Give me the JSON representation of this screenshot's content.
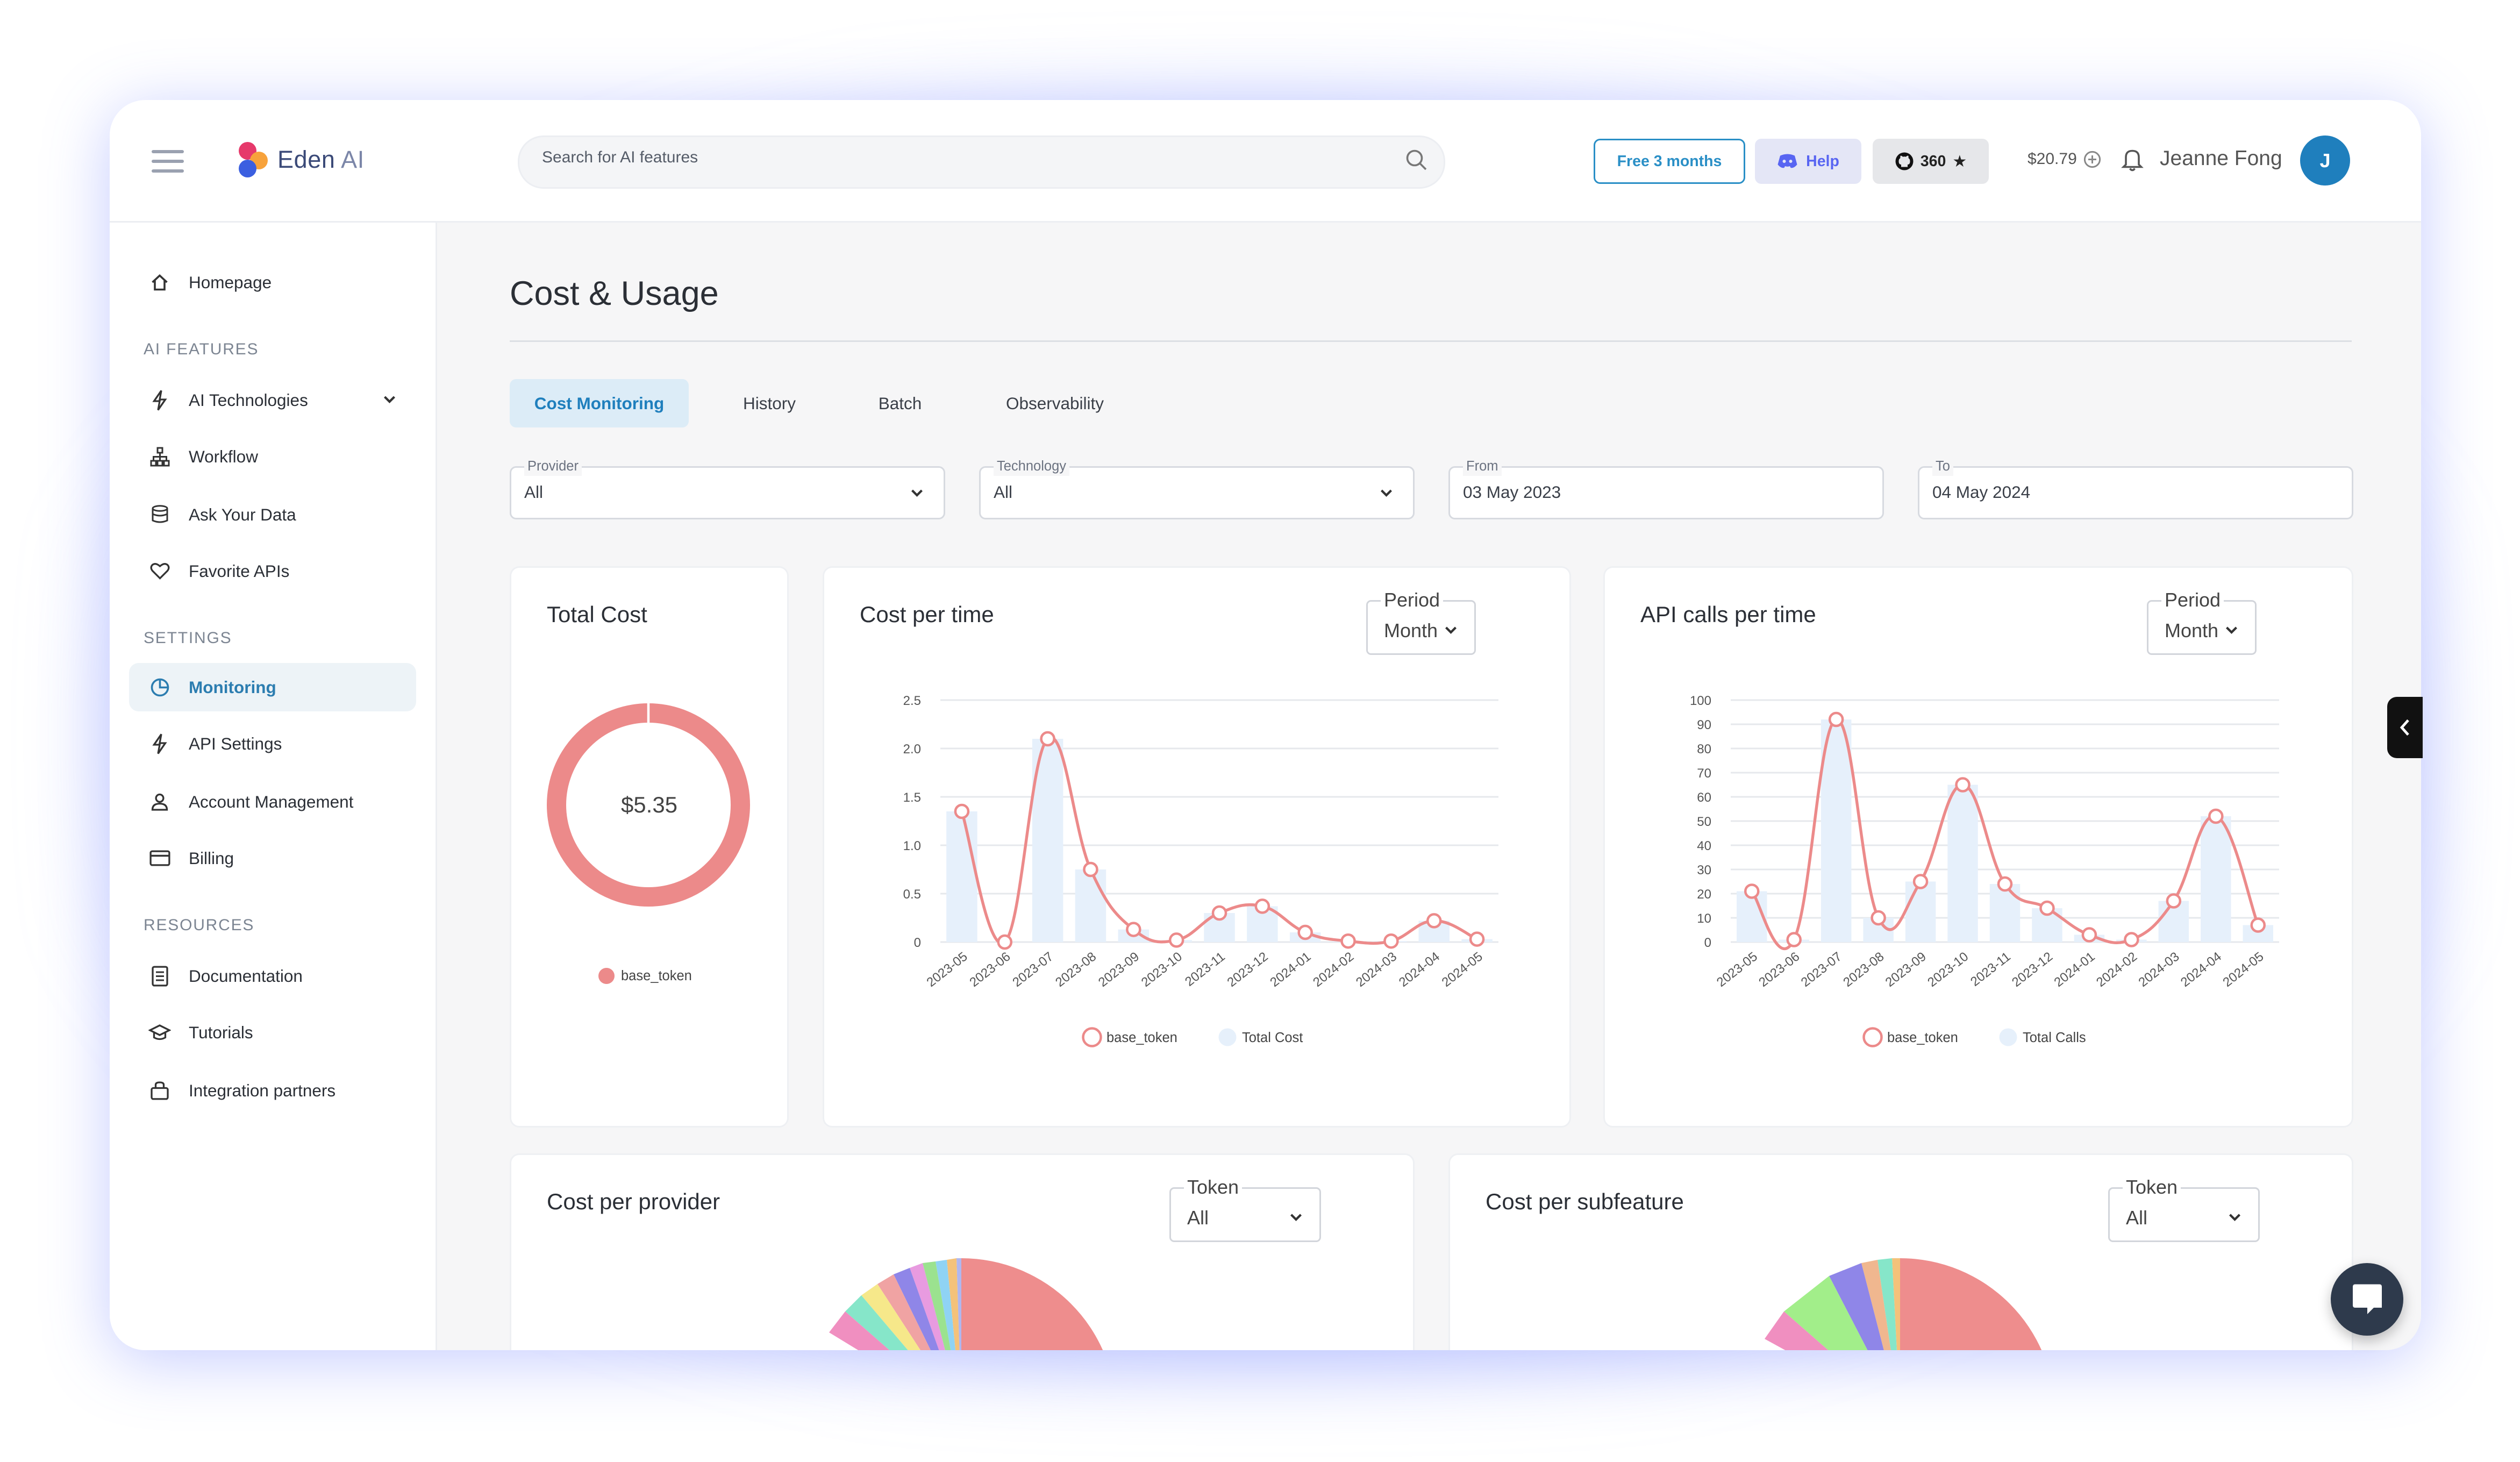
{
  "app": {
    "logo_text_main": "Eden",
    "logo_text_suffix": "AI"
  },
  "topbar": {
    "search_placeholder": "Search for AI features",
    "free_label": "Free 3 months",
    "help_label": "Help",
    "github_stars": "360",
    "balance": "$20.79",
    "username": "Jeanne Fong",
    "avatar_initial": "J"
  },
  "sidebar": {
    "homepage": "Homepage",
    "section_ai": "AI FEATURES",
    "ai_technologies": "AI Technologies",
    "workflow": "Workflow",
    "ask_your_data": "Ask Your Data",
    "favorite_apis": "Favorite APIs",
    "section_settings": "SETTINGS",
    "monitoring": "Monitoring",
    "api_settings": "API Settings",
    "account_management": "Account Management",
    "billing": "Billing",
    "section_resources": "RESOURCES",
    "documentation": "Documentation",
    "tutorials": "Tutorials",
    "integration_partners": "Integration partners"
  },
  "main": {
    "title": "Cost & Usage",
    "tabs": [
      "Cost Monitoring",
      "History",
      "Batch",
      "Observability"
    ],
    "filters": {
      "provider_label": "Provider",
      "provider_value": "All",
      "technology_label": "Technology",
      "technology_value": "All",
      "from_label": "From",
      "from_value": "03 May 2023",
      "to_label": "To",
      "to_value": "04 May 2024"
    }
  },
  "cards": {
    "total_cost_title": "Total Cost",
    "total_cost_value": "$5.35",
    "total_cost_legend": "base_token",
    "cost_per_time_title": "Cost per time",
    "api_calls_title": "API calls per time",
    "period_label": "Period",
    "period_value": "Month",
    "cost_per_provider_title": "Cost per provider",
    "cost_per_subfeature_title": "Cost per subfeature",
    "token_label": "Token",
    "token_value": "All"
  },
  "colors": {
    "accent": "#1f7fbd",
    "line": "#ec8a8a",
    "bar": "#e6f0fb"
  },
  "chart_data": [
    {
      "type": "line",
      "title": "Cost per time",
      "categories": [
        "2023-05",
        "2023-06",
        "2023-07",
        "2023-08",
        "2023-09",
        "2023-10",
        "2023-11",
        "2023-12",
        "2024-01",
        "2024-02",
        "2024-03",
        "2024-04",
        "2024-05"
      ],
      "yticks": [
        "0",
        "0.5",
        "1.0",
        "1.5",
        "2.0",
        "2.5"
      ],
      "ylim": [
        0,
        2.5
      ],
      "series": [
        {
          "name": "base_token",
          "kind": "line",
          "values": [
            1.35,
            0.0,
            2.1,
            0.75,
            0.13,
            0.02,
            0.3,
            0.37,
            0.1,
            0.01,
            0.01,
            0.22,
            0.03
          ]
        },
        {
          "name": "Total Cost",
          "kind": "bar",
          "values": [
            1.35,
            0.0,
            2.1,
            0.75,
            0.13,
            0.02,
            0.3,
            0.37,
            0.1,
            0.01,
            0.01,
            0.22,
            0.03
          ]
        }
      ],
      "grid": true,
      "legend": "bottom"
    },
    {
      "type": "line",
      "title": "API calls per time",
      "categories": [
        "2023-05",
        "2023-06",
        "2023-07",
        "2023-08",
        "2023-09",
        "2023-10",
        "2023-11",
        "2023-12",
        "2024-01",
        "2024-02",
        "2024-03",
        "2024-04",
        "2024-05"
      ],
      "yticks": [
        "0",
        "10",
        "20",
        "30",
        "40",
        "50",
        "60",
        "70",
        "80",
        "90",
        "100"
      ],
      "ylim": [
        0,
        100
      ],
      "series": [
        {
          "name": "base_token",
          "kind": "line",
          "values": [
            21,
            1,
            92,
            10,
            25,
            65,
            24,
            14,
            3,
            1,
            17,
            52,
            7
          ]
        },
        {
          "name": "Total Calls",
          "kind": "bar",
          "values": [
            21,
            1,
            92,
            10,
            25,
            65,
            24,
            14,
            3,
            1,
            17,
            52,
            7
          ]
        }
      ],
      "grid": true,
      "legend": "bottom"
    },
    {
      "type": "pie",
      "title": "Total Cost",
      "labels": [
        "base_token"
      ],
      "values": [
        5.35
      ]
    }
  ]
}
